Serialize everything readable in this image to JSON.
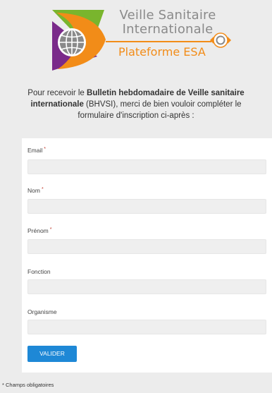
{
  "logo": {
    "title_line1": "Veille Sanitaire",
    "title_line2": "Internationale",
    "subtitle": "Plateforme ESA",
    "colors": {
      "green": "#79b52d",
      "purple": "#7a2a8a",
      "orange": "#f28c18",
      "grey": "#8a8a8a"
    }
  },
  "intro": {
    "part1": "Pour recevoir le ",
    "bold": "Bulletin hebdomadaire de Veille sanitaire internationale",
    "part2": " (BHVSI), merci de bien vouloir compléter le formulaire d'inscription ci-après :"
  },
  "form": {
    "required_marker": "*",
    "fields": [
      {
        "label": "Email",
        "required": true,
        "value": ""
      },
      {
        "label": "Nom",
        "required": true,
        "value": ""
      },
      {
        "label": "Prénom",
        "required": true,
        "value": ""
      },
      {
        "label": "Fonction",
        "required": false,
        "value": ""
      },
      {
        "label": "Organisme",
        "required": false,
        "value": ""
      }
    ],
    "submit_label": "VALIDER",
    "accent_color": "#1e88d6"
  },
  "footnote": "* Champs obligatoires"
}
